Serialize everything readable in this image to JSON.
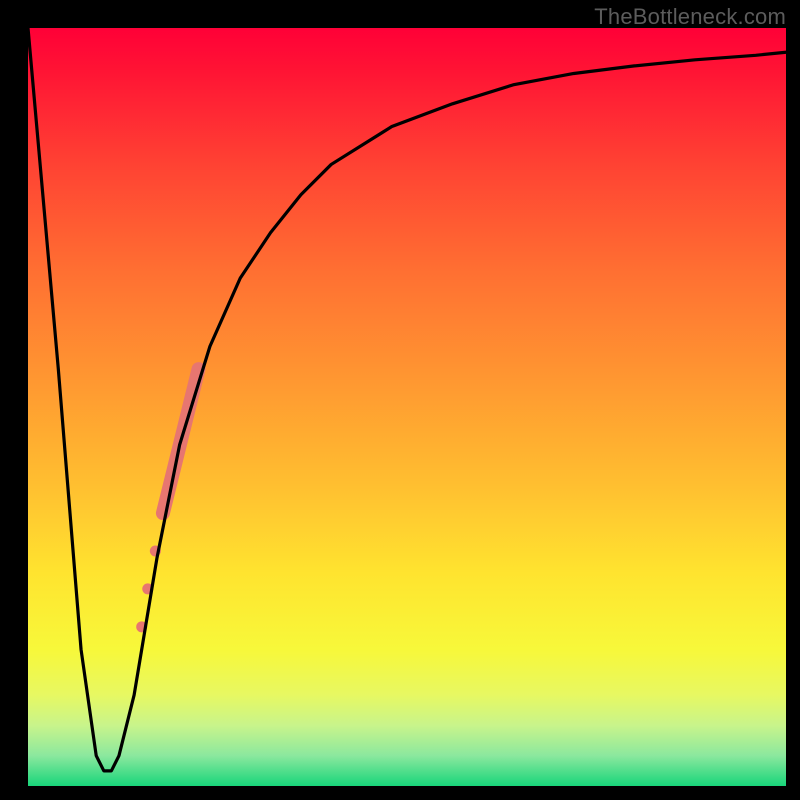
{
  "watermark": "TheBottleneck.com",
  "chart_data": {
    "type": "line",
    "title": "",
    "xlabel": "",
    "ylabel": "",
    "xlim": [
      0,
      100
    ],
    "ylim": [
      0,
      100
    ],
    "grid": false,
    "series": [
      {
        "name": "curve",
        "color": "#000000",
        "x": [
          0,
          4,
          7,
          9,
          10,
          11,
          12,
          14,
          17,
          20,
          24,
          28,
          32,
          36,
          40,
          48,
          56,
          64,
          72,
          80,
          88,
          96,
          100
        ],
        "y": [
          100,
          55,
          18,
          4,
          2,
          2,
          4,
          12,
          30,
          45,
          58,
          67,
          73,
          78,
          82,
          87,
          90,
          92.5,
          94,
          95,
          95.8,
          96.4,
          96.8
        ]
      }
    ],
    "markers": [
      {
        "name": "dot-1",
        "x": 15.0,
        "y": 21,
        "r": 5.5,
        "color": "#e77670"
      },
      {
        "name": "dot-2",
        "x": 15.8,
        "y": 26,
        "r": 5.5,
        "color": "#e77670"
      },
      {
        "name": "dot-3",
        "x": 16.8,
        "y": 31,
        "r": 5.5,
        "color": "#e77670"
      }
    ],
    "bars": [
      {
        "name": "thick-segment",
        "x1": 17.8,
        "y1": 36,
        "x2": 22.5,
        "y2": 55,
        "width": 14,
        "color": "#e77670"
      }
    ]
  }
}
